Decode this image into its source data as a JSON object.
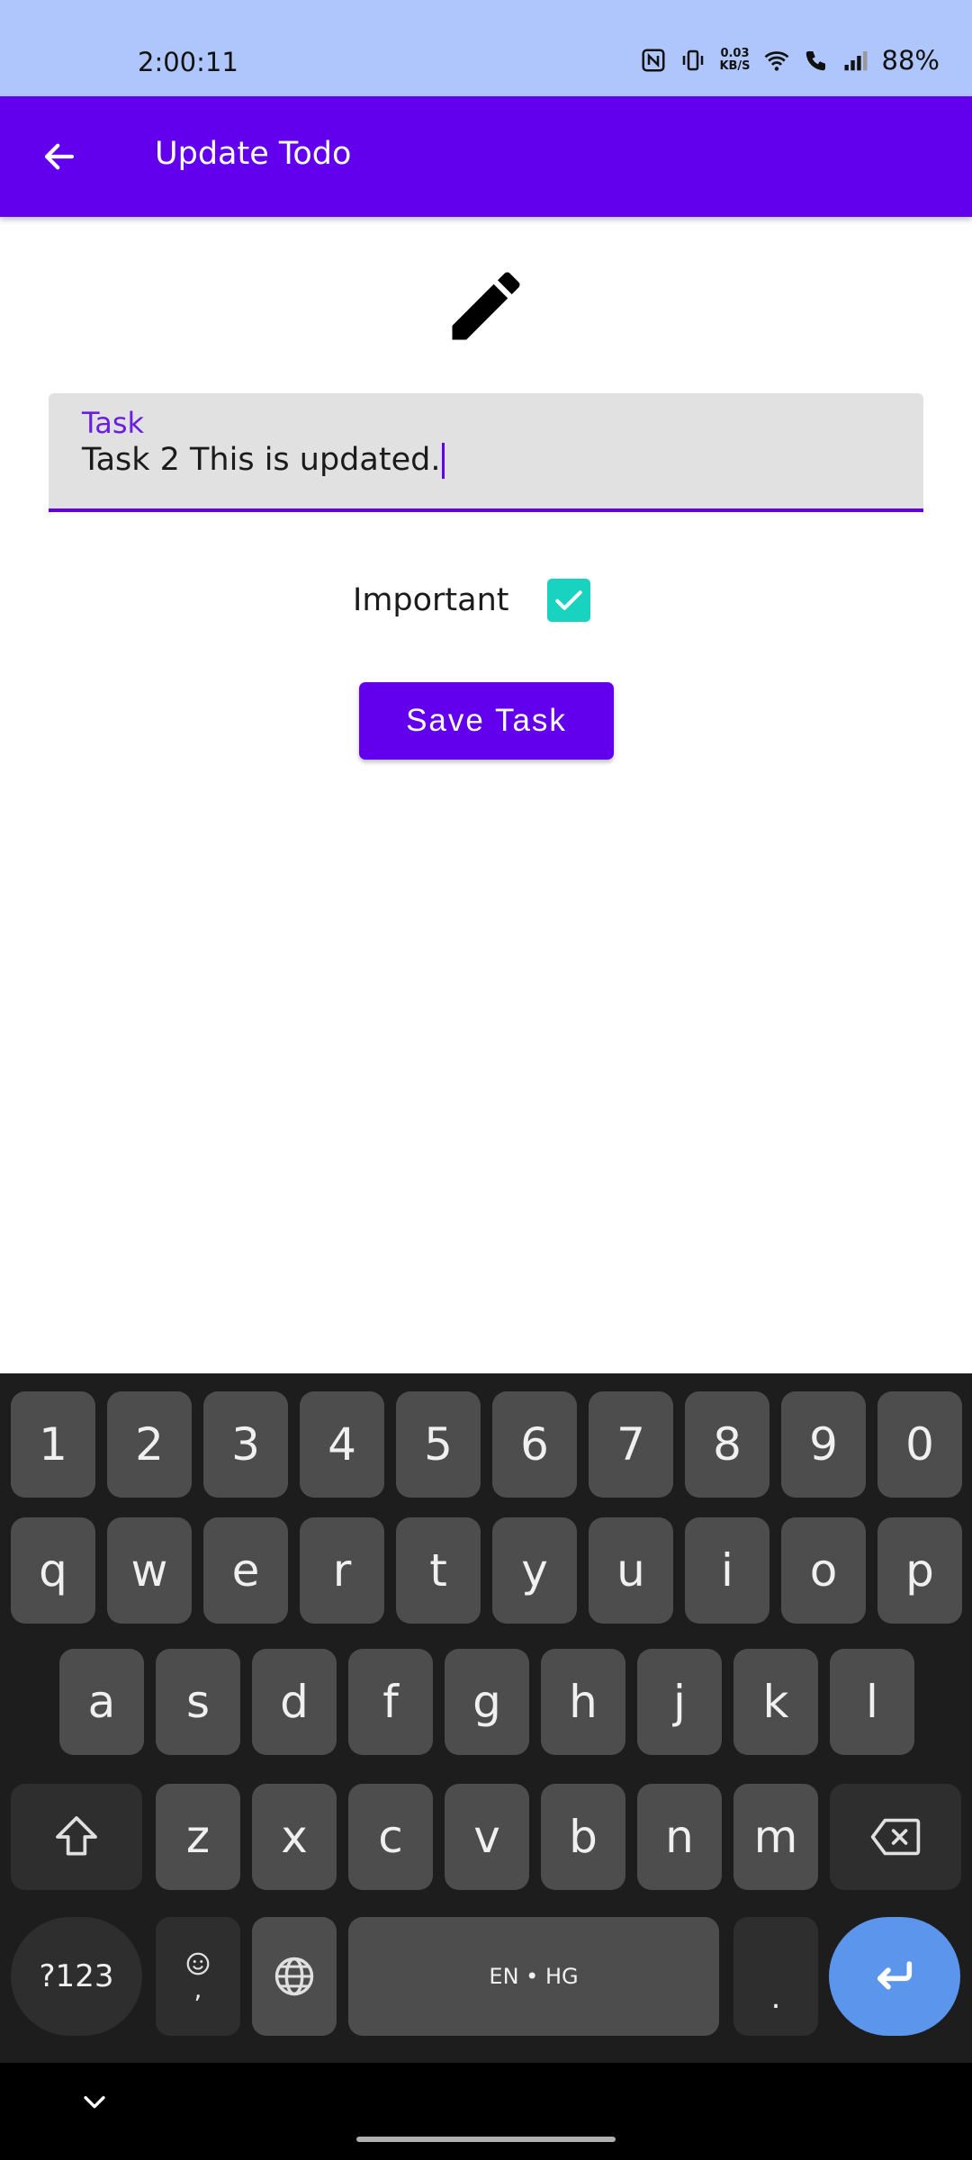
{
  "status_bar": {
    "time": "2:00:11",
    "net_speed_value": "0.03",
    "net_speed_unit": "KB/S",
    "battery": "88%"
  },
  "app_bar": {
    "title": "Update Todo"
  },
  "form": {
    "task_label": "Task",
    "task_value": "Task 2 This is updated.",
    "important_label": "Important",
    "important_checked": true,
    "save_button": "Save Task"
  },
  "keyboard": {
    "row_numbers": [
      "1",
      "2",
      "3",
      "4",
      "5",
      "6",
      "7",
      "8",
      "9",
      "0"
    ],
    "row_1": [
      "q",
      "w",
      "e",
      "r",
      "t",
      "y",
      "u",
      "i",
      "o",
      "p"
    ],
    "row_2": [
      "a",
      "s",
      "d",
      "f",
      "g",
      "h",
      "j",
      "k",
      "l"
    ],
    "row_3": [
      "z",
      "x",
      "c",
      "v",
      "b",
      "n",
      "m"
    ],
    "symbols_key": "?123",
    "comma_key": ",",
    "space_label": "EN • HG",
    "period_key": "."
  },
  "colors": {
    "primary": "#6200ee",
    "status_bar": "#aec6fc",
    "checkbox": "#18d3c0",
    "enter_key": "#5b95ec"
  }
}
